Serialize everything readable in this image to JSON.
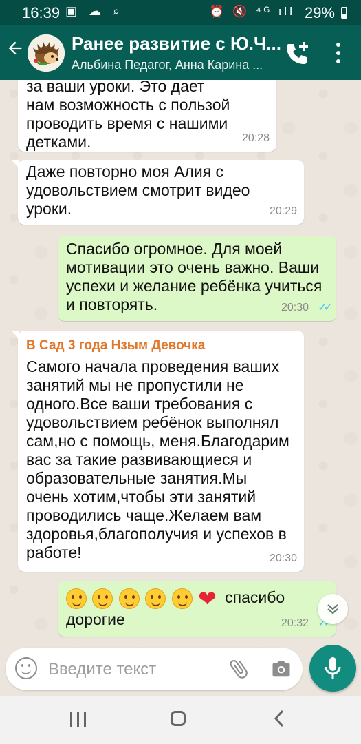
{
  "status_bar": {
    "time": "16:39",
    "left_icons": "▣ ☁ ⌕",
    "right_icons": "⏰ 🔇 ⁴ᴳ ıll",
    "battery_percent": "29%"
  },
  "app_bar": {
    "back_icon": "arrow-left",
    "chat_title": "Ранее развитие с Ю.Ч...",
    "participants": "Альбина Педагог, Анна Карина ...",
    "actions": [
      "add-call-icon",
      "more-vert-icon"
    ]
  },
  "messages": [
    {
      "direction": "in",
      "text": "за ваши уроки. Это дает\nнам возможность с пользой\nпроводить время с нашими\nдетками.",
      "time": "20:28"
    },
    {
      "direction": "in",
      "text": "Даже повторно моя Алия с\nудовольствием смотрит видео\nуроки.",
      "time": "20:29"
    },
    {
      "direction": "out",
      "text": "Спасибо огромное.  Для моей\nмотивации это очень важно.  Ваши\nуспехи и желание ребёнка учиться\nи повторять.",
      "time": "20:30",
      "status": "✓✓"
    },
    {
      "direction": "in",
      "sender": "В Сад 3 года Нзым Девочка",
      "text": "Самого начала проведения ваших\nзанятий мы не пропустили не\nодного.Все ваши требования с\nудовольствием ребёнок выполнял\nсам,но с помощь, меня.Благодарим\nвас за такие развивающиеся и\nобразовательные занятия.Мы\nочень хотим,чтобы эти занятий\nпроводились чаще.Желаем вам\nздоровья,благополучия и успехов в\nработе!",
      "time": "20:30"
    },
    {
      "direction": "out",
      "emoji_count": 5,
      "emoji_heart": "❤",
      "text_line1": "спасибо",
      "text_line2": "дорогие",
      "time": "20:32",
      "status": "✓✓"
    }
  ],
  "scroll_down": "⌄⌄",
  "composer": {
    "placeholder": "Введите текст",
    "value": ""
  },
  "colors": {
    "header": "#075e54",
    "status_bar": "#054d44",
    "outgoing_bubble": "#dcf8c6",
    "incoming_bubble": "#ffffff",
    "sender_name": "#e0772a",
    "read_ticks": "#4fc3f7",
    "mic_button": "#128c7e"
  }
}
